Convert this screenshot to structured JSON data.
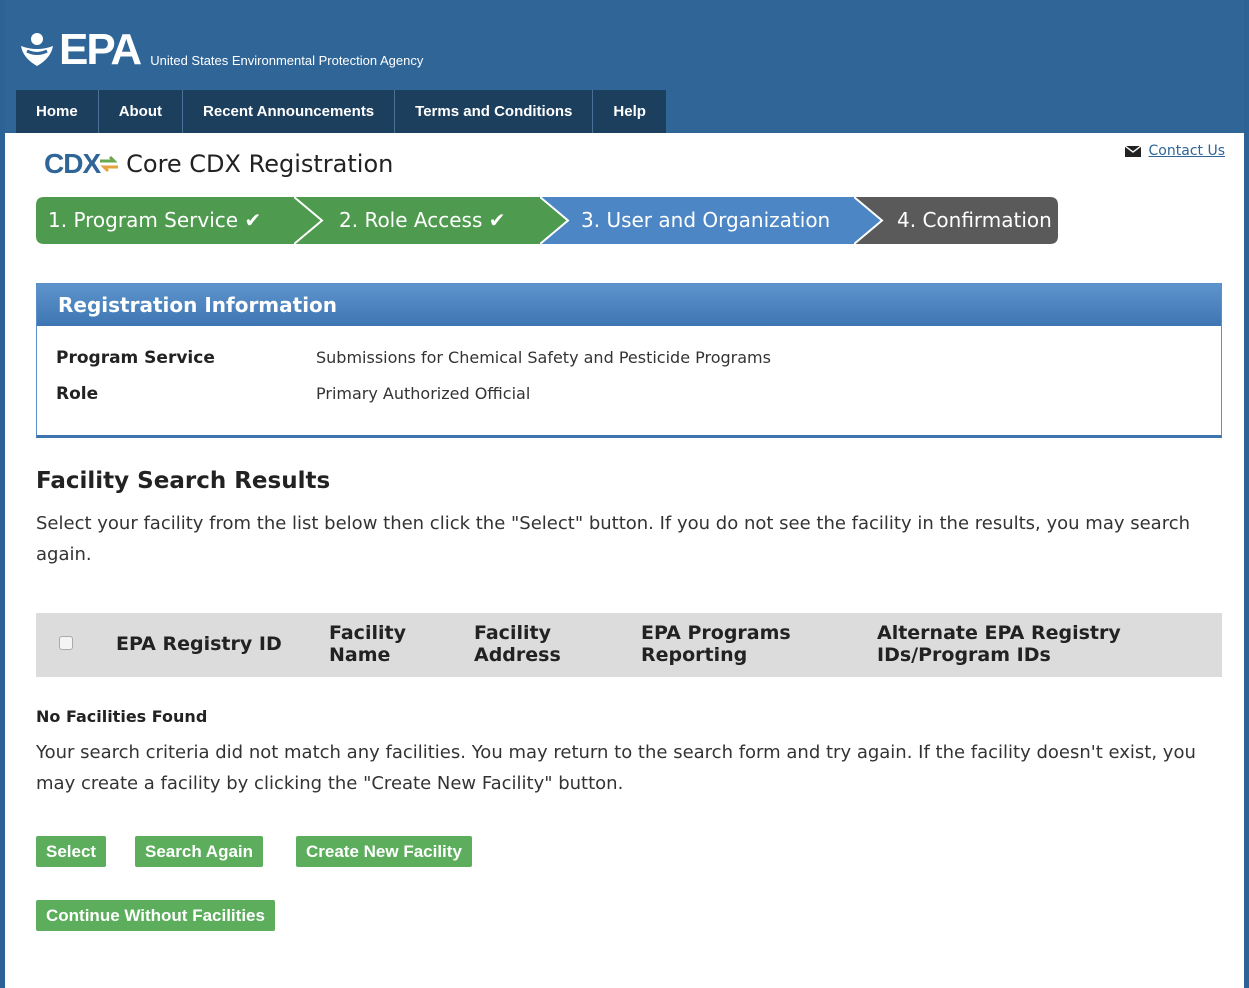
{
  "header": {
    "logo_text": "EPA",
    "agency_name": "United States Environmental Protection Agency"
  },
  "nav": {
    "items": [
      "Home",
      "About",
      "Recent Announcements",
      "Terms and Conditions",
      "Help"
    ]
  },
  "contact": {
    "label": "Contact Us",
    "icon": "mail-icon"
  },
  "page": {
    "logo_text": "CDX",
    "title": "Core CDX Registration"
  },
  "steps": [
    {
      "label": "1. Program Service",
      "status": "complete",
      "color": "#4e9a4e"
    },
    {
      "label": "2. Role Access",
      "status": "complete",
      "color": "#4e9a4e"
    },
    {
      "label": "3. User and Organization",
      "status": "current",
      "color": "#4d86c4"
    },
    {
      "label": "4. Confirmation",
      "status": "pending",
      "color": "#5a5a5a"
    }
  ],
  "registration": {
    "heading": "Registration Information",
    "rows": [
      {
        "key": "Program Service",
        "value": "Submissions for Chemical Safety and Pesticide Programs"
      },
      {
        "key": "Role",
        "value": "Primary Authorized Official"
      }
    ]
  },
  "facility": {
    "title": "Facility Search Results",
    "description": "Select your facility from the list below then click the \"Select\" button. If you do not see the facility in the results, you may search again.",
    "columns": [
      "EPA Registry ID",
      "Facility Name",
      "Facility Address",
      "EPA Programs Reporting",
      "Alternate EPA Registry IDs/Program IDs"
    ],
    "empty_title": "No Facilities Found",
    "empty_description": "Your search criteria did not match any facilities. You may return to the search form and try again. If the facility doesn't exist, you may create a facility by clicking the \"Create New Facility\" button."
  },
  "buttons": {
    "select": "Select",
    "search_again": "Search Again",
    "create_new": "Create New Facility",
    "continue_without": "Continue Without Facilities"
  }
}
